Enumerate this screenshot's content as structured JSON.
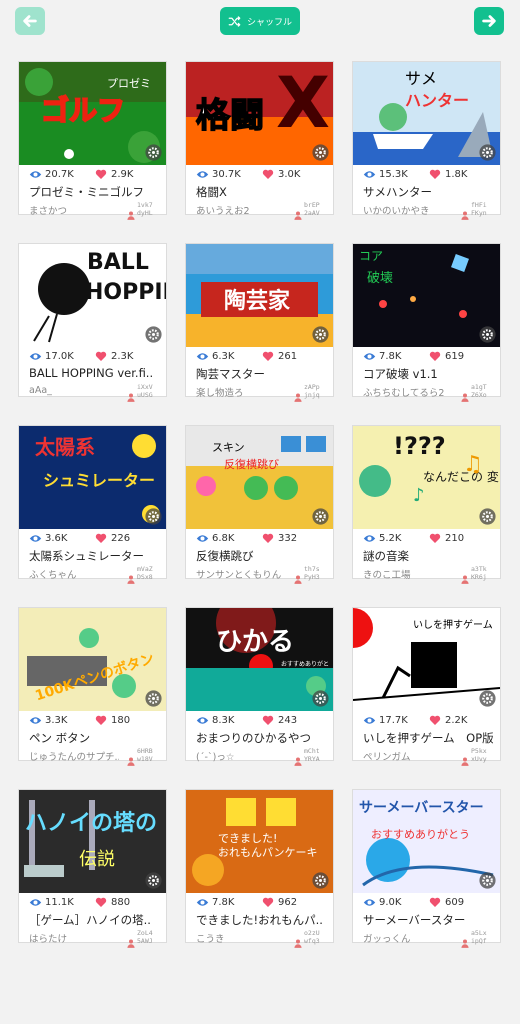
{
  "toolbar": {
    "shuffle_label": "シャッフル",
    "back_icon": "arrow-left-icon",
    "next_icon": "arrow-right-icon",
    "accent": "#12c08f",
    "accent_disabled": "#9fe3cd"
  },
  "games": [
    {
      "title": "プロゼミ・ミニゴルフ",
      "author": "まさかつ",
      "views": "20.7K",
      "likes": "2.9K",
      "id1": "1vk7",
      "id2": "dyHL",
      "thumb_text": "ゴルフ",
      "thumb_sub": "プロゼミ"
    },
    {
      "title": "格闘X",
      "author": "あいうえお2",
      "views": "30.7K",
      "likes": "3.0K",
      "id1": "brEP",
      "id2": "2aAV",
      "thumb_text": "格闘",
      "thumb_sub": "X"
    },
    {
      "title": "サメハンター",
      "author": "いかのいかやき",
      "views": "15.3K",
      "likes": "1.8K",
      "id1": "fHFi",
      "id2": "FKyn",
      "thumb_text": "サメ",
      "thumb_sub": "ハンター"
    },
    {
      "title": "BALL HOPPING ver.fi..",
      "author": "aAa_",
      "views": "17.0K",
      "likes": "2.3K",
      "id1": "iXxV",
      "id2": "uUSG",
      "thumb_text": "BALL",
      "thumb_sub": "HOPPIN"
    },
    {
      "title": "陶芸マスター",
      "author": "楽し物造ろ",
      "views": "6.3K",
      "likes": "261",
      "id1": "zAPp",
      "id2": "jnjq",
      "thumb_text": "陶芸家",
      "thumb_sub": ""
    },
    {
      "title": "コア破壊 v1.1",
      "author": "ふちちむしてるら2",
      "views": "7.8K",
      "likes": "619",
      "id1": "a1gT",
      "id2": "Z6Xo",
      "thumb_text": "コア",
      "thumb_sub": "破壊"
    },
    {
      "title": "太陽系シュミレーター",
      "author": "ふくちゃん",
      "views": "3.6K",
      "likes": "226",
      "id1": "mVaZ",
      "id2": "DSx8",
      "thumb_text": "太陽系",
      "thumb_sub": "シュミレーター"
    },
    {
      "title": "反復横跳び",
      "author": "サンサンとくもりん",
      "views": "6.8K",
      "likes": "332",
      "id1": "th7s",
      "id2": "PyH3",
      "thumb_text": "反復横跳び",
      "thumb_sub": "スキン"
    },
    {
      "title": "謎の音楽",
      "author": "きのこ工場",
      "views": "5.2K",
      "likes": "210",
      "id1": "a3Tk",
      "id2": "KR6j",
      "thumb_text": "!???",
      "thumb_sub": "なんだこの 変なリズム"
    },
    {
      "title": "ペン ボタン",
      "author": "じゅうたんのサプチ..",
      "views": "3.3K",
      "likes": "180",
      "id1": "6HRB",
      "id2": "w18V",
      "thumb_text": "100Kペンのボタン",
      "thumb_sub": ""
    },
    {
      "title": "おまつりのひかるやつ",
      "author": "(´-`)っ☆",
      "views": "8.3K",
      "likes": "243",
      "id1": "mCht",
      "id2": "YRYA",
      "thumb_text": "ひかる",
      "thumb_sub": "おすすめありがと"
    },
    {
      "title": "いしを押すゲーム　OP版",
      "author": "ペリンガム",
      "views": "17.7K",
      "likes": "2.2K",
      "id1": "P5kx",
      "id2": "xUvy",
      "thumb_text": "いしを押すゲーム",
      "thumb_sub": ""
    },
    {
      "title": "［ゲーム］ハノイの塔..",
      "author": "はらたけ",
      "views": "11.1K",
      "likes": "880",
      "id1": "ZoL4",
      "id2": "5AWJ",
      "thumb_text": "ハノイの塔の",
      "thumb_sub": "伝説"
    },
    {
      "title": "できました!おれもんパ..",
      "author": "こうき",
      "views": "7.8K",
      "likes": "962",
      "id1": "o2zU",
      "id2": "wfq3",
      "thumb_text": "できました!",
      "thumb_sub": "おれもんパンケーキ"
    },
    {
      "title": "サーメーバースター",
      "author": "ガッっくん",
      "views": "9.0K",
      "likes": "609",
      "id1": "a5Lx",
      "id2": "ipQf",
      "thumb_text": "サーメーバースター",
      "thumb_sub": "おすすめありがとう"
    }
  ]
}
